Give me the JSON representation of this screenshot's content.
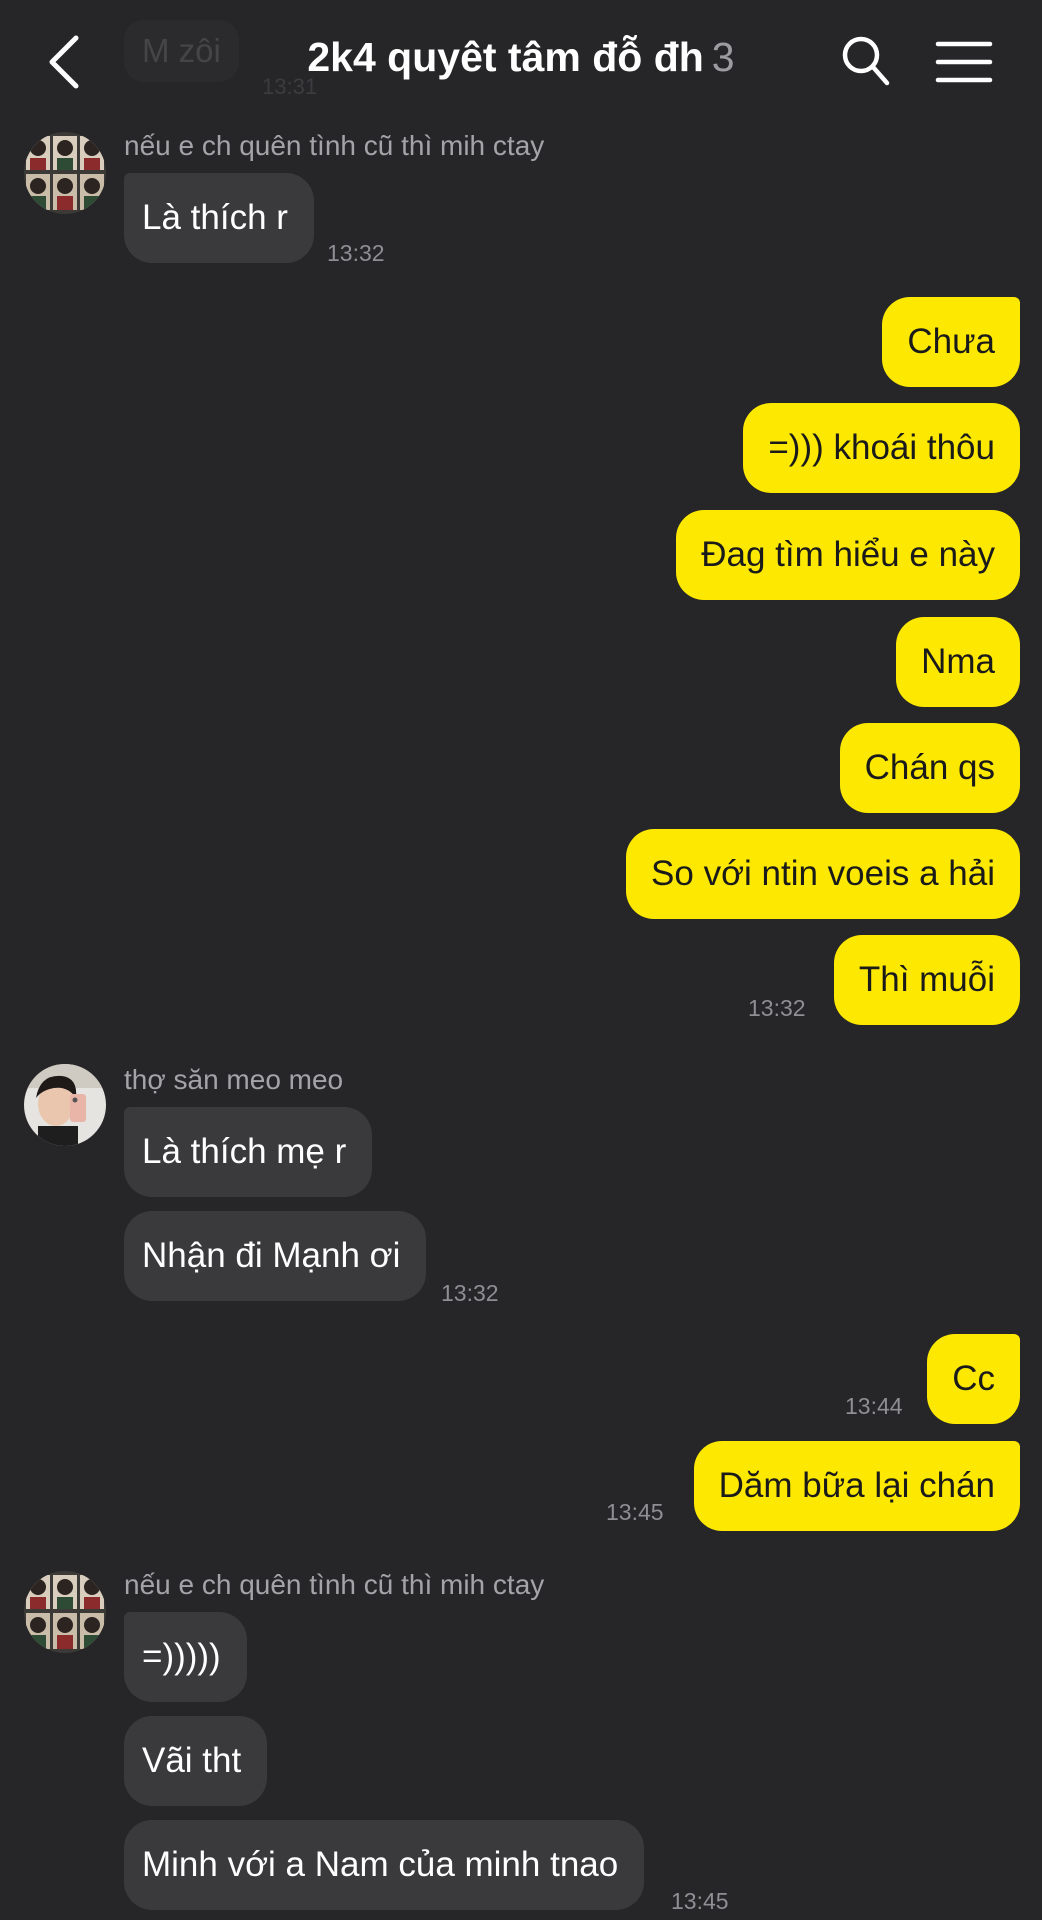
{
  "ghost": {
    "text": "M zôi",
    "time": "13:31"
  },
  "header": {
    "title": "2k4 quyêt tâm đỗ đh",
    "member_count": "3"
  },
  "messages": {
    "sender_a": "nếu e ch quên tình cũ thì mih ctay",
    "sender_b": "thợ săn meo meo",
    "m1": "Là thích r",
    "t1": "13:32",
    "o1": "Chưa",
    "o2": "=))) khoái thôu",
    "o3": "Đag tìm hiểu e này",
    "o4": "Nma",
    "o5": "Chán qs",
    "o6": "So với ntin voeis a hải",
    "o7": "Thì muỗi",
    "t2": "13:32",
    "b1": "Là thích mẹ r",
    "b2": "Nhận đi Mạnh ơi",
    "t3": "13:32",
    "o8": "Cc",
    "t4": "13:44",
    "o9": "Dăm bữa lại chán",
    "t5": "13:45",
    "a1": "=)))))",
    "a2": "Vãi tht",
    "a3": "Minh với a Nam của minh tnao",
    "t6": "13:45"
  },
  "colors": {
    "background": "#262628",
    "outgoing": "#fce800",
    "incoming": "#3a3a3c"
  },
  "icons": [
    "back-icon",
    "search-icon",
    "menu-icon"
  ]
}
